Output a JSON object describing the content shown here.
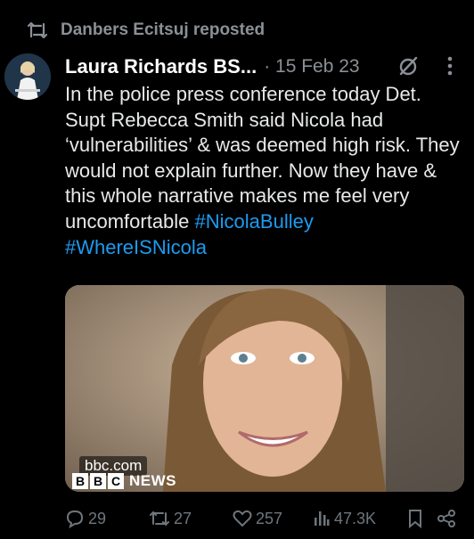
{
  "repost": {
    "text": "Danbers Ecitsuj reposted",
    "icon": "repost-icon"
  },
  "post": {
    "author_name": "Laura Richards BS...",
    "date": "· 15 Feb 23",
    "text": "In the police press conference today Det. Supt Rebecca Smith said Nicola had ‘vulnerabilities’ & was deemed high risk. They would not explain further. Now they have & this whole narrative makes me feel very uncomfortable",
    "hashtags": [
      "#NicolaBulley",
      "#WhereISNicola"
    ],
    "media": {
      "source_label": "bbc.com",
      "logo_letters": [
        "B",
        "B",
        "C"
      ],
      "logo_word": "NEWS"
    }
  },
  "actions": {
    "replies": "29",
    "reposts": "27",
    "likes": "257",
    "views": "47.3K"
  },
  "colors": {
    "background": "#000000",
    "text": "#e7e9ea",
    "muted": "#8b9096",
    "link": "#1d9bf0"
  }
}
